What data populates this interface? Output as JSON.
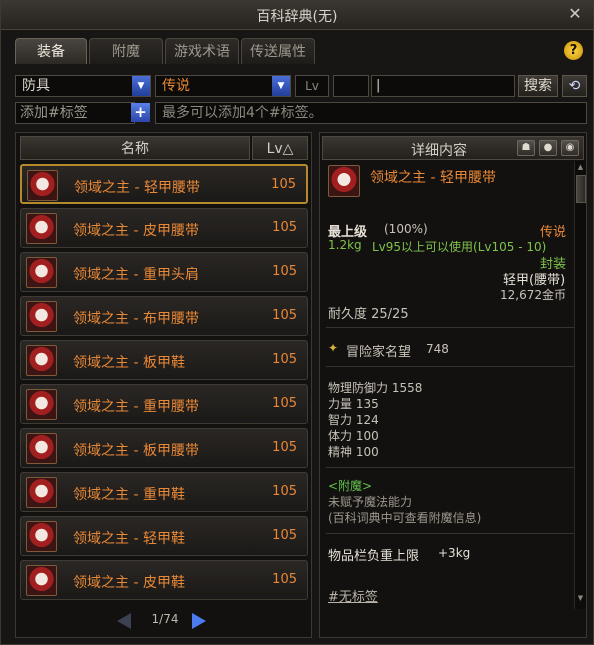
{
  "window": {
    "title": "百科辞典(无)",
    "close_glyph": "✕"
  },
  "tabs": [
    {
      "label": "装备",
      "active": true
    },
    {
      "label": "附魔",
      "active": false
    },
    {
      "label": "游戏术语",
      "active": false
    },
    {
      "label": "传送属性",
      "active": false
    }
  ],
  "help_glyph": "?",
  "filters": {
    "category_value": "防具",
    "rarity_value": "传说",
    "lv_label": "Lv",
    "lv_value": "",
    "search_value": "|",
    "search_label": "搜索",
    "refresh_glyph": "⟲"
  },
  "tags": {
    "add_label": "添加#标签",
    "plus_glyph": "+",
    "hint": "最多可以添加4个#标签。"
  },
  "list": {
    "header_name": "名称",
    "header_lv": "Lv△",
    "items": [
      {
        "name": "领域之主 - 轻甲腰带",
        "lv": "105",
        "icon": "belt-icon"
      },
      {
        "name": "领域之主 - 皮甲腰带",
        "lv": "105",
        "icon": "belt-icon"
      },
      {
        "name": "领域之主 - 重甲头肩",
        "lv": "105",
        "icon": "shoulder-icon"
      },
      {
        "name": "领域之主 - 布甲腰带",
        "lv": "105",
        "icon": "belt-icon"
      },
      {
        "name": "领域之主 - 板甲鞋",
        "lv": "105",
        "icon": "boots-icon"
      },
      {
        "name": "领域之主 - 重甲腰带",
        "lv": "105",
        "icon": "belt-icon"
      },
      {
        "name": "领域之主 - 板甲腰带",
        "lv": "105",
        "icon": "belt-icon"
      },
      {
        "name": "领域之主 - 重甲鞋",
        "lv": "105",
        "icon": "boots-icon"
      },
      {
        "name": "领域之主 - 轻甲鞋",
        "lv": "105",
        "icon": "boots-icon"
      },
      {
        "name": "领域之主 - 皮甲鞋",
        "lv": "105",
        "icon": "boots-icon"
      }
    ],
    "pager": {
      "current": "1",
      "total": "74",
      "text": "1/74"
    }
  },
  "detail": {
    "header": "详细内容",
    "header_icons": [
      "wardrobe-icon",
      "gear-icon",
      "eye-icon"
    ],
    "item_name": "领域之主 - 轻甲腰带",
    "grade": "最上级",
    "grade_pct": "(100%)",
    "rarity": "传说",
    "weight": "1.2kg",
    "level_req": "Lv95以上可以使用(Lv105 - 10)",
    "sealed": "封装",
    "type": "轻甲(腰带)",
    "price": "12,672金币",
    "durability": "耐久度 25/25",
    "fame_label": "冒险家名望",
    "fame_value": "748",
    "stats": [
      "物理防御力 1558",
      "力量 135",
      "智力 124",
      "体力 100",
      "精神 100"
    ],
    "enchant_title": "<附魔>",
    "enchant_line1": "未赋予魔法能力",
    "enchant_line2": "(百科词典中可查看附魔信息)",
    "carry_label": "物品栏负重上限",
    "carry_value": "+3kg",
    "no_tag": "#无标签"
  },
  "colors": {
    "item_name": "#e98836",
    "legendary": "#e98836",
    "req_green": "#7fc24a",
    "enchant_green": "#62c24a",
    "white_text": "#e6e0d6",
    "gray_text": "#9d978c"
  }
}
